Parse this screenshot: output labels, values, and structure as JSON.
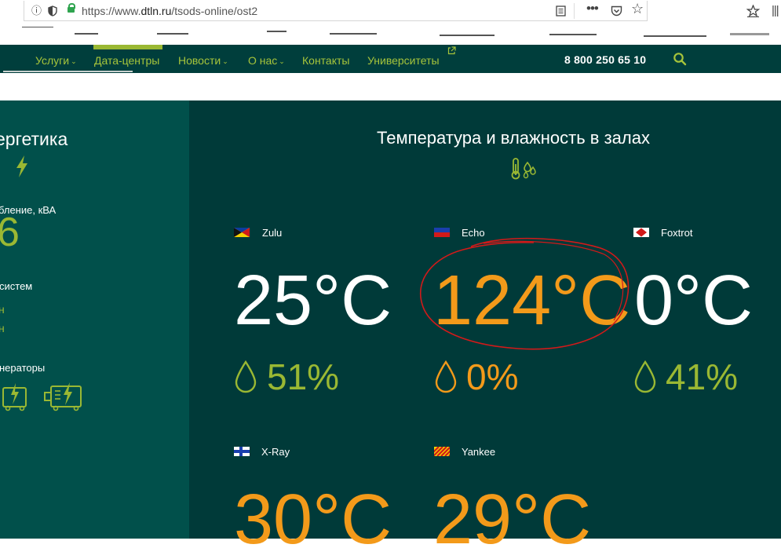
{
  "browser": {
    "url_prefix": "https://www.",
    "url_domain": "dtln.ru",
    "url_path": "/tsods-online/ost2",
    "buttons": [
      "reader-view",
      "more",
      "pocket",
      "bookmark-star",
      "library",
      "sidebar"
    ]
  },
  "nav": {
    "items": [
      {
        "label": "Услуги",
        "dropdown": true
      },
      {
        "label": "Дата-центры",
        "dropdown": false,
        "active": true
      },
      {
        "label": "Новости",
        "dropdown": true
      },
      {
        "label": "О нас",
        "dropdown": true
      },
      {
        "label": "Контакты",
        "dropdown": false
      },
      {
        "label": "Университеты",
        "dropdown": false,
        "external": true
      }
    ],
    "phone": "8 800 250 65 10",
    "chevron": "⌄"
  },
  "left_panel": {
    "title": "ергетика",
    "consumption_label": "бление, кВА",
    "consumption_value": "6",
    "systems_label": "систем",
    "systems_values": [
      "н",
      "н"
    ],
    "generators_label": "нераторы"
  },
  "main": {
    "title": "Температура и влажность в залах",
    "halls": [
      {
        "name": "Zulu",
        "temperature": "25°C",
        "humidity": "51%",
        "temp_state": "normal",
        "humidity_state": "normal"
      },
      {
        "name": "Echo",
        "temperature": "124°C",
        "humidity": "0%",
        "temp_state": "alert",
        "humidity_state": "alert"
      },
      {
        "name": "Foxtrot",
        "temperature": "0°C",
        "humidity": "41%",
        "temp_state": "normal",
        "humidity_state": "normal"
      },
      {
        "name": "X-Ray",
        "temperature": "30°C",
        "temp_state": "alert"
      },
      {
        "name": "Yankee",
        "temperature": "29°C",
        "temp_state": "alert"
      }
    ]
  },
  "colors": {
    "accent_green": "#9ab833",
    "alert_orange": "#f39a1a",
    "panel_dark": "#003a39",
    "panel_left": "#01504b",
    "annotation_red": "#d11a1a"
  }
}
